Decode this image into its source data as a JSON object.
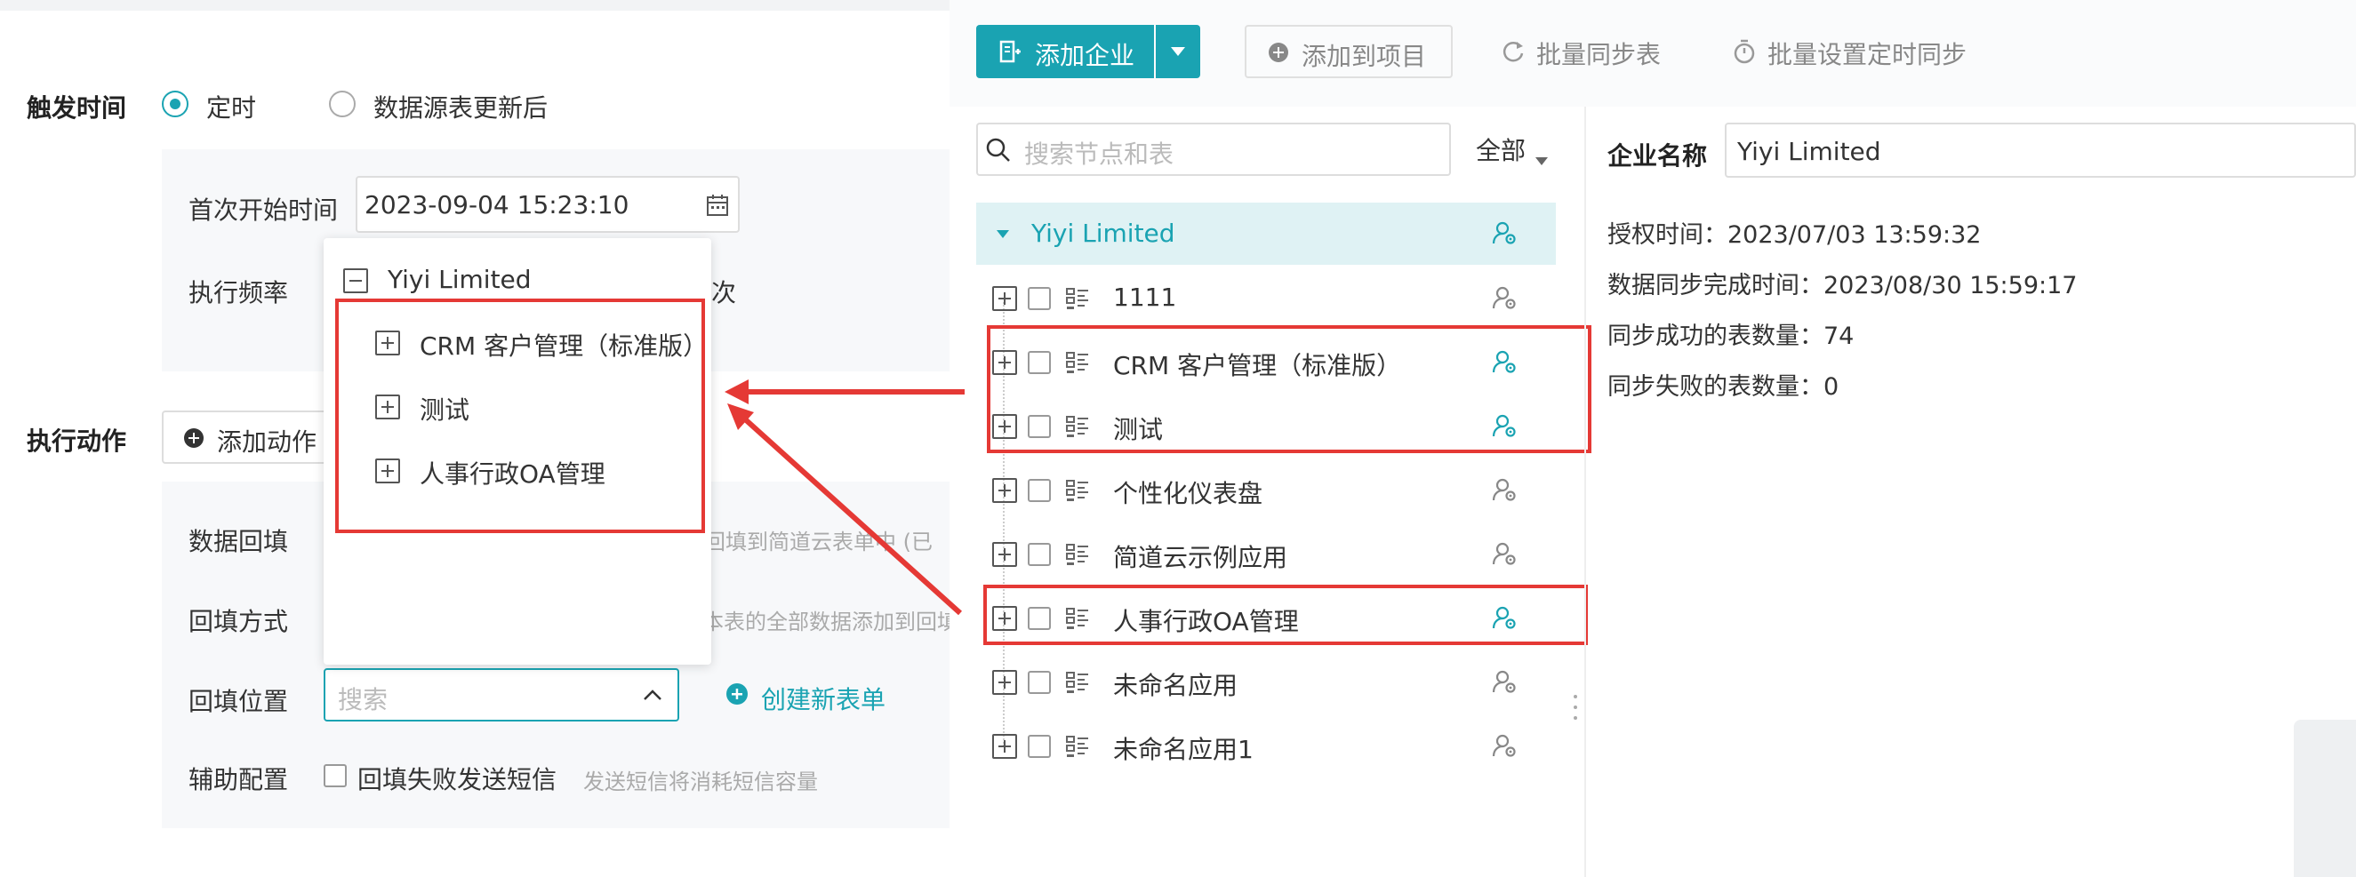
{
  "trigger": {
    "label": "触发时间",
    "options": [
      "定时",
      "数据源表更新后"
    ],
    "selected": "定时",
    "first_start_label": "首次开始时间",
    "first_start_value": "2023-09-04 15:23:10",
    "frequency_label": "执行频率",
    "frequency_suffix": "次"
  },
  "action": {
    "label": "执行动作",
    "add_button": "添加动作",
    "backfill_label": "数据回填",
    "backfill_desc": "将回填到简道云表单中 (已",
    "method_label": "回填方式",
    "method_desc": "本表的全部数据添加到回填",
    "position_label": "回填位置",
    "position_placeholder": "搜索",
    "create_form": "创建新表单",
    "aux_label": "辅助配置",
    "aux_checkbox": "回填失败发送短信",
    "aux_hint": "发送短信将消耗短信容量"
  },
  "dropdown": {
    "root": "Yiyi Limited",
    "items": [
      "CRM 客户管理（标准版）",
      "测试",
      "人事行政OA管理"
    ]
  },
  "toolbar": {
    "add_company": "添加企业",
    "add_to_project": "添加到项目",
    "batch_sync": "批量同步表",
    "batch_schedule": "批量设置定时同步"
  },
  "tree": {
    "search_placeholder": "搜索节点和表",
    "filter": "全部",
    "root": "Yiyi Limited",
    "items": [
      {
        "label": "1111",
        "highlight": false,
        "active_icon": false
      },
      {
        "label": "CRM 客户管理（标准版）",
        "highlight": true,
        "active_icon": true
      },
      {
        "label": "测试",
        "highlight": true,
        "active_icon": true
      },
      {
        "label": "个性化仪表盘",
        "highlight": false,
        "active_icon": false
      },
      {
        "label": "简道云示例应用",
        "highlight": false,
        "active_icon": false
      },
      {
        "label": "人事行政OA管理",
        "highlight": true,
        "active_icon": true
      },
      {
        "label": "未命名应用",
        "highlight": false,
        "active_icon": false
      },
      {
        "label": "未命名应用1",
        "highlight": false,
        "active_icon": false
      }
    ]
  },
  "detail": {
    "name_label": "企业名称",
    "name_value": "Yiyi Limited",
    "auth_time": "授权时间：2023/07/03 13:59:32",
    "sync_done_time": "数据同步完成时间：2023/08/30 15:59:17",
    "success_count": "同步成功的表数量：74",
    "fail_count": "同步失败的表数量：0"
  },
  "colors": {
    "accent": "#1aa3b2",
    "red": "#e53935"
  }
}
